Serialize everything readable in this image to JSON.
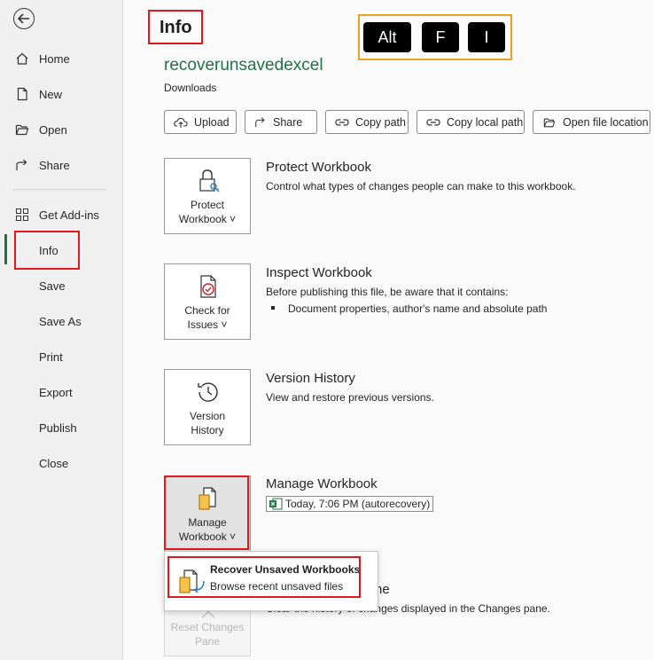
{
  "sidebar": {
    "items": [
      {
        "label": "Home",
        "icon": "home-icon"
      },
      {
        "label": "New",
        "icon": "new-document-icon"
      },
      {
        "label": "Open",
        "icon": "open-folder-icon"
      },
      {
        "label": "Share",
        "icon": "share-icon"
      },
      {
        "label": "Get Add-ins",
        "icon": "add-ins-grid-icon"
      },
      {
        "label": "Info",
        "icon": ""
      },
      {
        "label": "Save",
        "icon": ""
      },
      {
        "label": "Save As",
        "icon": ""
      },
      {
        "label": "Print",
        "icon": ""
      },
      {
        "label": "Export",
        "icon": ""
      },
      {
        "label": "Publish",
        "icon": ""
      },
      {
        "label": "Close",
        "icon": ""
      }
    ],
    "active": "Info"
  },
  "header": {
    "title": "Info"
  },
  "shortcut_keys": [
    "Alt",
    "F",
    "I"
  ],
  "file": {
    "name": "recoverunsavedexcel",
    "location": "Downloads"
  },
  "actions": [
    "Upload",
    "Share",
    "Copy path",
    "Copy local path",
    "Open file location"
  ],
  "sections": {
    "protect": {
      "tile_line1": "Protect",
      "tile_line2": "Workbook ˅",
      "title": "Protect Workbook",
      "desc": "Control what types of changes people can make to this workbook."
    },
    "inspect": {
      "tile_line1": "Check for",
      "tile_line2": "Issues ˅",
      "title": "Inspect Workbook",
      "desc": "Before publishing this file, be aware that it contains:",
      "bullet": "Document properties, author's name and absolute path"
    },
    "version": {
      "tile_line1": "Version",
      "tile_line2": "History",
      "title": "Version History",
      "desc": "View and restore previous versions."
    },
    "manage": {
      "tile_line1": "Manage",
      "tile_line2": "Workbook ˅",
      "title": "Manage Workbook",
      "entry": "Today, 7:06 PM (autorecovery)"
    },
    "changes": {
      "tile_line1": "Reset Changes",
      "tile_line2": "Pane",
      "title_partial": "ne",
      "desc_partial": "Clear the history of changes displayed in the Changes pane."
    }
  },
  "dropdown": {
    "title": "Recover Unsaved Workbooks",
    "desc": "Browse recent unsaved files"
  },
  "colors": {
    "accent": "#217346",
    "highlight": "#e0191e",
    "keys_border": "#e9a120"
  }
}
